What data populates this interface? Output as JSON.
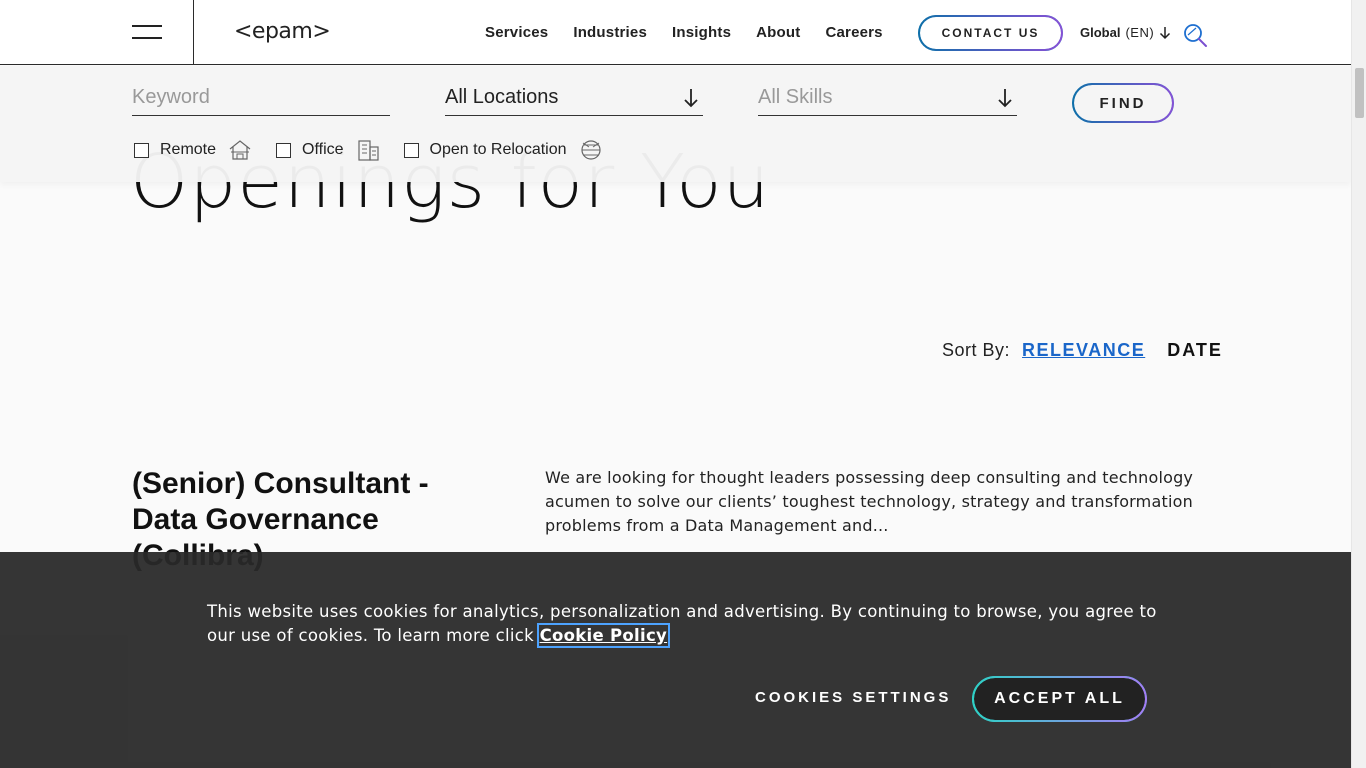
{
  "header": {
    "menu_icon": "hamburger-menu-icon",
    "logo": "<epam>",
    "nav": [
      {
        "label": "Services"
      },
      {
        "label": "Industries"
      },
      {
        "label": "Insights"
      },
      {
        "label": "About"
      },
      {
        "label": "Careers"
      }
    ],
    "contact_label": "CONTACT US",
    "lang_label": "Global",
    "lang_code": "(EN)",
    "search_icon": "search-icon"
  },
  "filters": {
    "keyword_placeholder": "Keyword",
    "location_value": "All Locations",
    "skills_value": "All Skills",
    "find_label": "FIND",
    "checkboxes": [
      {
        "label": "Remote",
        "icon": "home-icon",
        "checked": false
      },
      {
        "label": "Office",
        "icon": "office-building-icon",
        "checked": false
      },
      {
        "label": "Open to Relocation",
        "icon": "globe-relocation-icon",
        "checked": false
      }
    ]
  },
  "headline": "Openings for You",
  "sort": {
    "label": "Sort By:",
    "relevance": "RELEVANCE",
    "date": "DATE"
  },
  "job": {
    "title": "(Senior) Consultant - Data Governance (Collibra)",
    "description": "We are looking for thought leaders possessing deep consulting and technology acumen to solve our clients’ toughest technology, strategy and transformation problems from a Data Management and..."
  },
  "cookie": {
    "text": "This website uses cookies for analytics, personalization and advertising. By continuing to browse, you agree to our use of cookies. To learn more click ",
    "link": "Cookie Policy",
    "settings_label": "COOKIES SETTINGS",
    "accept_label": "ACCEPT ALL"
  },
  "colors": {
    "accent_blue": "#1a66c9",
    "button_gradient_start": "#0f6fa8",
    "button_gradient_end": "#8a4fd6",
    "cookie_bg": "#282828"
  }
}
